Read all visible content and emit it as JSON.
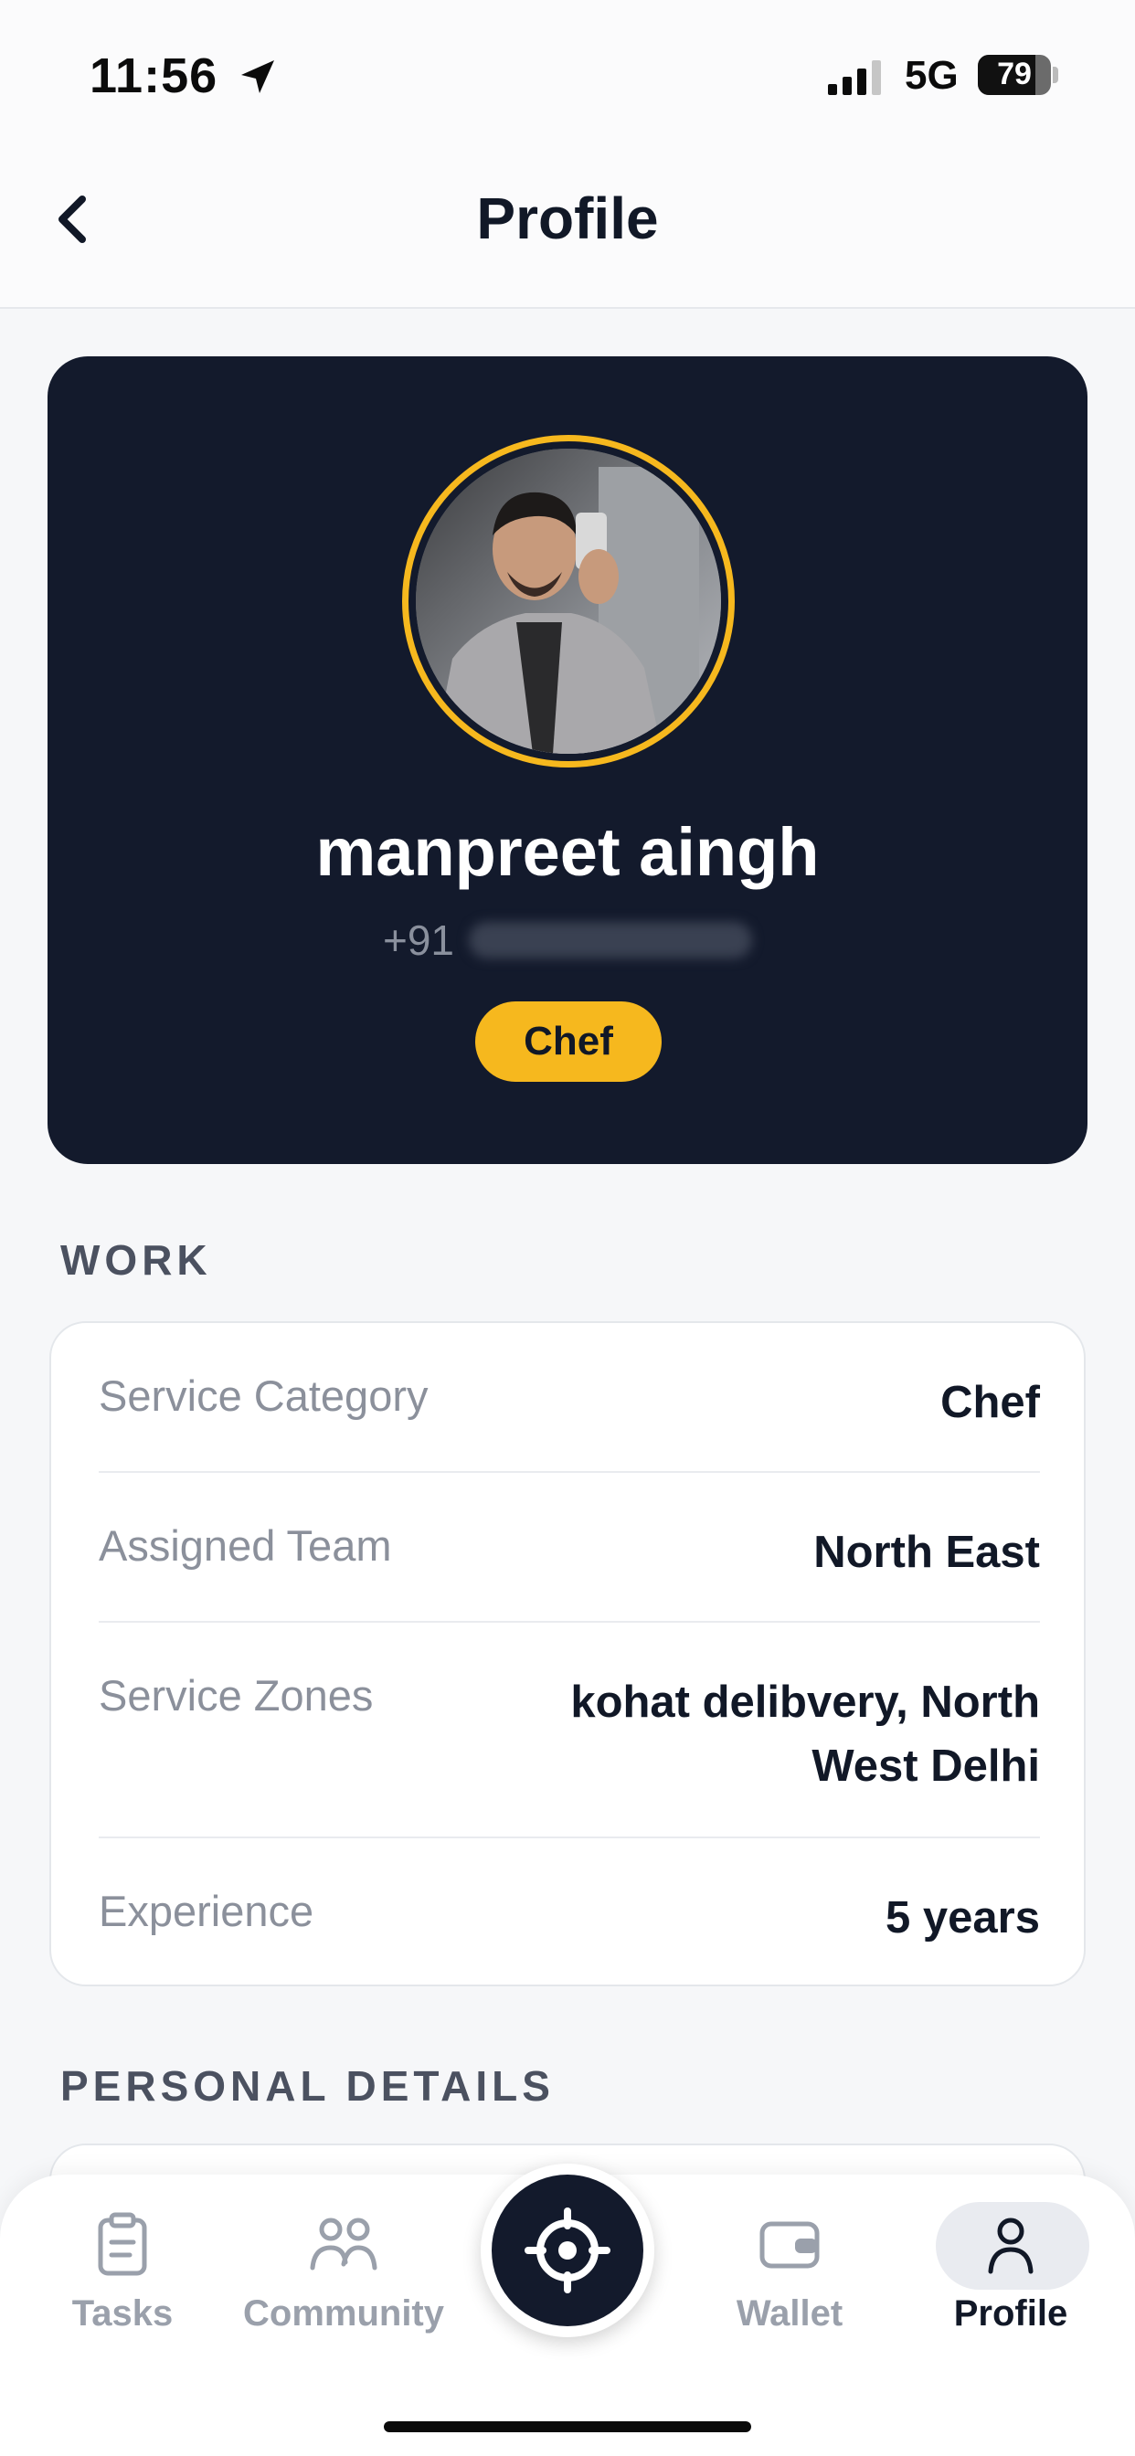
{
  "status_bar": {
    "time": "11:56",
    "network": "5G",
    "battery": "79",
    "battery_fraction": 0.79,
    "icons": [
      "location-arrow-icon",
      "signal-bars-icon",
      "battery-icon"
    ]
  },
  "header": {
    "title": "Profile",
    "back_icon": "chevron-left-icon"
  },
  "profile": {
    "name": "manpreet aingh",
    "phone_prefix": "+91",
    "role": "Chef",
    "avatar_icon": "profile-photo",
    "accent_color": "#f6b81e",
    "card_color": "#131a2c"
  },
  "work": {
    "section_title": "WORK",
    "rows": [
      {
        "label": "Service Category",
        "value": "Chef"
      },
      {
        "label": "Assigned Team",
        "value": "North East"
      },
      {
        "label": "Service Zones",
        "value_line1": "kohat delibvery, North",
        "value_line2": "West Delhi"
      },
      {
        "label": "Experience",
        "value": "5 years"
      }
    ]
  },
  "personal": {
    "section_title": "PERSONAL DETAILS"
  },
  "tab_bar": {
    "tabs": [
      {
        "label": "Tasks",
        "icon": "clipboard-icon",
        "active": false
      },
      {
        "label": "Community",
        "icon": "people-icon",
        "active": false
      },
      {
        "label": "Wallet",
        "icon": "wallet-icon",
        "active": false
      },
      {
        "label": "Profile",
        "icon": "person-icon",
        "active": true
      }
    ],
    "center_action_icon": "crosshair-icon"
  }
}
